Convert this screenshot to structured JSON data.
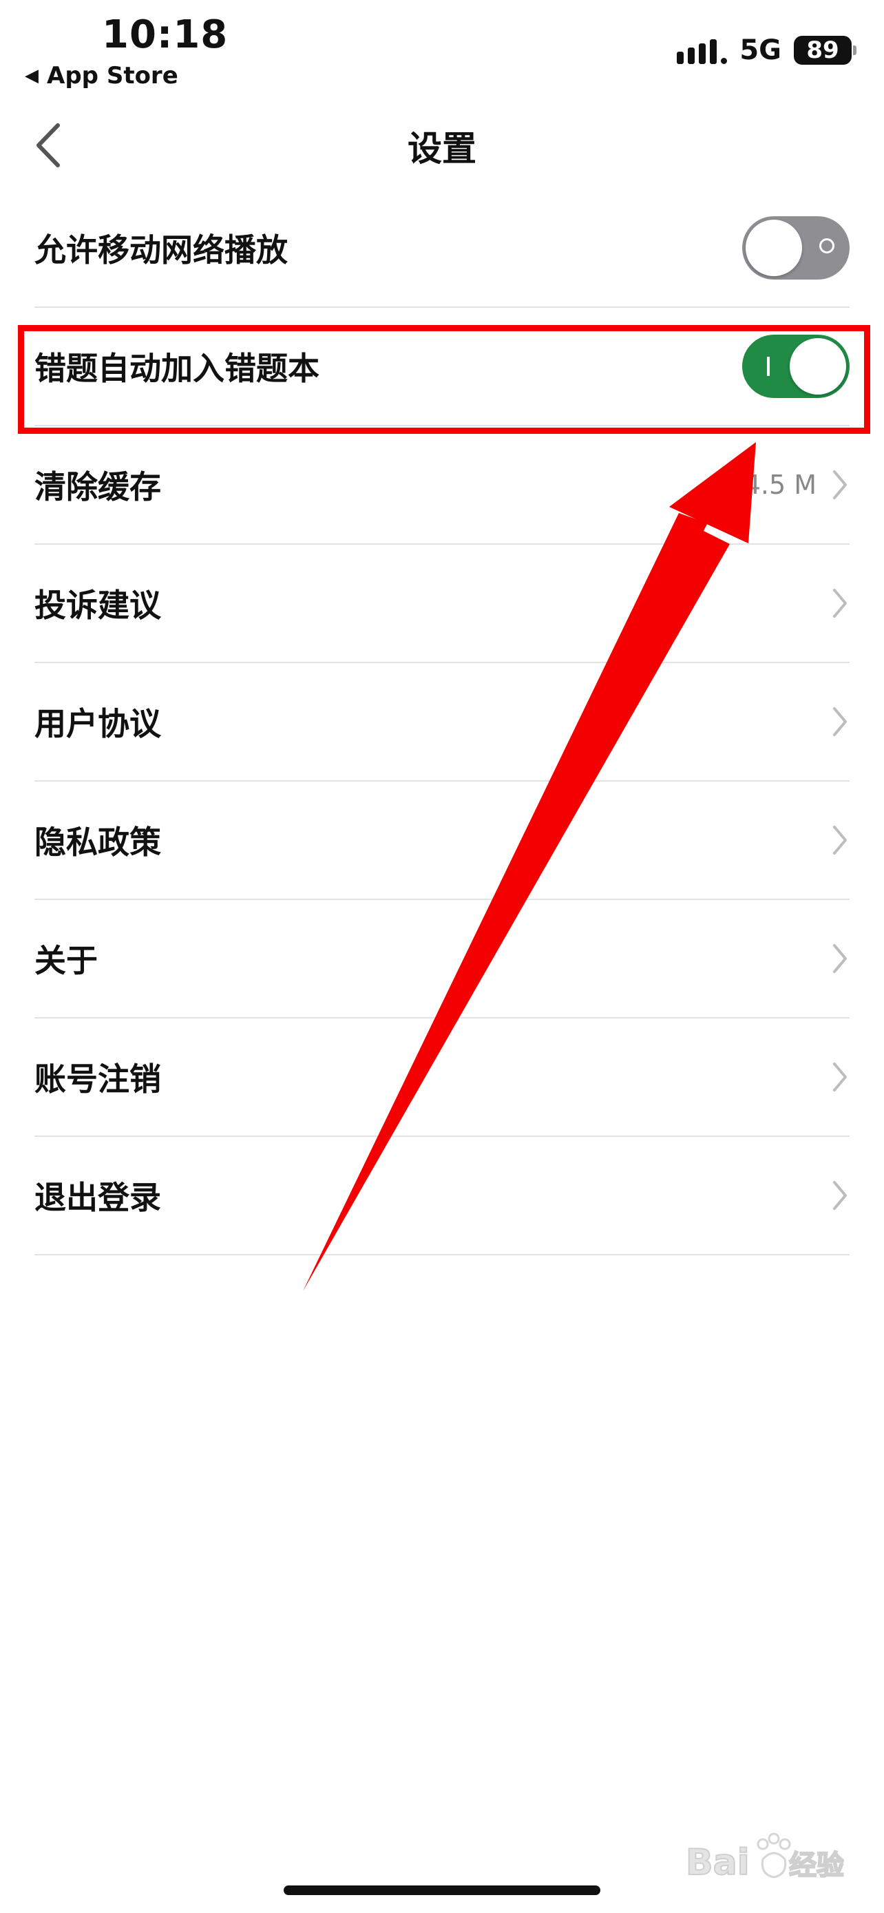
{
  "status_bar": {
    "time": "10:18",
    "back_app": "App Store",
    "network": "5G",
    "battery": "89"
  },
  "nav": {
    "title": "设置",
    "back_icon": "chevron-left-icon"
  },
  "settings": [
    {
      "label": "允许移动网络播放",
      "control": "toggle",
      "state": "off"
    },
    {
      "label": "错题自动加入错题本",
      "control": "toggle",
      "state": "on"
    },
    {
      "label": "清除缓存",
      "control": "chevron",
      "value": "4.5 M"
    },
    {
      "label": "投诉建议",
      "control": "chevron"
    },
    {
      "label": "用户协议",
      "control": "chevron"
    },
    {
      "label": "隐私政策",
      "control": "chevron"
    },
    {
      "label": "关于",
      "control": "chevron"
    },
    {
      "label": "账号注销",
      "control": "chevron"
    },
    {
      "label": "退出登录",
      "control": "chevron"
    }
  ],
  "colors": {
    "toggle_on": "#1f8b45",
    "toggle_off": "#8e8e93",
    "annotation": "#f40000",
    "divider": "#e3e3e3"
  },
  "watermark": "Baidu经验"
}
